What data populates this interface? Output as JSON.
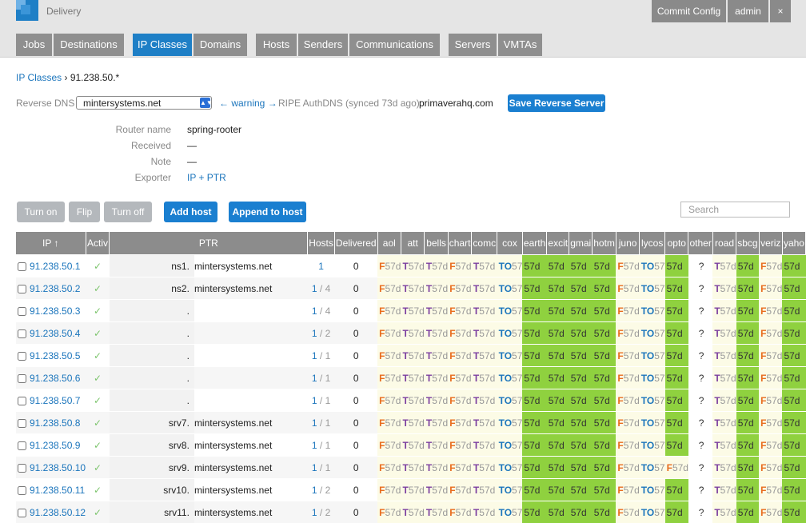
{
  "app": {
    "title": "Delivery"
  },
  "top_buttons": {
    "commit": "Commit Config",
    "user": "admin",
    "close": "×"
  },
  "tabs": [
    {
      "label": "Jobs"
    },
    {
      "label": "Destinations"
    },
    {
      "label": "IP Classes"
    },
    {
      "label": "Domains"
    },
    {
      "label": "Hosts"
    },
    {
      "label": "Senders"
    },
    {
      "label": "Communications"
    },
    {
      "label": "Servers"
    },
    {
      "label": "VMTAs"
    }
  ],
  "breadcrumb": {
    "root": "IP Classes",
    "sep": "›",
    "current": "91.238.50.*"
  },
  "reverse_dns": {
    "label": "Reverse DNS",
    "selected": "mintersystems.net",
    "warning": "← warning →",
    "ripe": "RIPE AuthDNS (synced 73d ago):",
    "ripe_value": "primaverahq.com",
    "save_label": "Save Reverse Server"
  },
  "info": {
    "router_label": "Router name",
    "router_value": "spring-rooter",
    "received_label": "Received",
    "received_value": "—",
    "note_label": "Note",
    "note_value": "—",
    "exporter_label": "Exporter",
    "exporter_value": "IP + PTR"
  },
  "actions": {
    "turn_on": "Turn on",
    "flip": "Flip",
    "turn_off": "Turn off",
    "add_host": "Add host",
    "append_host": "Append to host"
  },
  "search": {
    "placeholder": "Search"
  },
  "table": {
    "headers": {
      "ip": "IP ↑",
      "active": "Activ",
      "ptr": "PTR",
      "hosts": "Hosts",
      "delivered": "Delivered"
    },
    "providers": [
      "aol",
      "att",
      "bells",
      "chart",
      "comc",
      "cox",
      "earth",
      "excit",
      "gmai",
      "hotm",
      "juno",
      "lycos",
      "opto",
      "other",
      "road",
      "sbcg",
      "veriz",
      "yaho"
    ],
    "rows": [
      {
        "ip": "91.238.50.1",
        "active": "✓",
        "ptr_left": "ns1.",
        "ptr_right": "mintersystems.net",
        "hosts_a": "1",
        "hosts_b": "",
        "delivered": "0"
      },
      {
        "ip": "91.238.50.2",
        "active": "✓",
        "ptr_left": "ns2.",
        "ptr_right": "mintersystems.net",
        "hosts_a": "1",
        "hosts_b": "/ 4",
        "delivered": "0"
      },
      {
        "ip": "91.238.50.3",
        "active": "✓",
        "ptr_left": ".",
        "ptr_right": "",
        "hosts_a": "1",
        "hosts_b": "/ 4",
        "delivered": "0"
      },
      {
        "ip": "91.238.50.4",
        "active": "✓",
        "ptr_left": ".",
        "ptr_right": "",
        "hosts_a": "1",
        "hosts_b": "/ 2",
        "delivered": "0"
      },
      {
        "ip": "91.238.50.5",
        "active": "✓",
        "ptr_left": ".",
        "ptr_right": "",
        "hosts_a": "1",
        "hosts_b": "/ 1",
        "delivered": "0"
      },
      {
        "ip": "91.238.50.6",
        "active": "✓",
        "ptr_left": ".",
        "ptr_right": "",
        "hosts_a": "1",
        "hosts_b": "/ 1",
        "delivered": "0"
      },
      {
        "ip": "91.238.50.7",
        "active": "✓",
        "ptr_left": ".",
        "ptr_right": "",
        "hosts_a": "1",
        "hosts_b": "/ 1",
        "delivered": "0"
      },
      {
        "ip": "91.238.50.8",
        "active": "✓",
        "ptr_left": "srv7.",
        "ptr_right": "mintersystems.net",
        "hosts_a": "1",
        "hosts_b": "/ 1",
        "delivered": "0"
      },
      {
        "ip": "91.238.50.9",
        "active": "✓",
        "ptr_left": "srv8.",
        "ptr_right": "mintersystems.net",
        "hosts_a": "1",
        "hosts_b": "/ 1",
        "delivered": "0"
      },
      {
        "ip": "91.238.50.10",
        "active": "✓",
        "ptr_left": "srv9.",
        "ptr_right": "mintersystems.net",
        "hosts_a": "1",
        "hosts_b": "/ 1",
        "delivered": "0"
      },
      {
        "ip": "91.238.50.11",
        "active": "✓",
        "ptr_left": "srv10.",
        "ptr_right": "mintersystems.net",
        "hosts_a": "1",
        "hosts_b": "/ 2",
        "delivered": "0"
      },
      {
        "ip": "91.238.50.12",
        "active": "✓",
        "ptr_left": "srv11.",
        "ptr_right": "mintersystems.net",
        "hosts_a": "1",
        "hosts_b": "/ 2",
        "delivered": "0"
      }
    ]
  },
  "cell_kinds": {
    "F": {
      "prefix": "F",
      "text": "57d"
    },
    "T": {
      "prefix": "T",
      "text": "57d"
    },
    "TO": {
      "prefix": "TO",
      "text": "57"
    },
    "G": {
      "prefix": "",
      "text": "57d"
    },
    "Q": {
      "prefix": "",
      "text": "?"
    }
  },
  "colors": {
    "accent": "#1e7fc6",
    "green": "#8fd13f",
    "cream": "#fcfbe6"
  }
}
